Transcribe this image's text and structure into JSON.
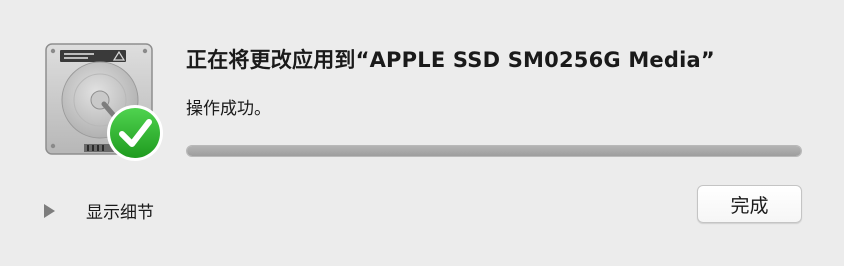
{
  "dialog": {
    "title": "正在将更改应用到“APPLE SSD SM0256G Media”",
    "status": "操作成功。",
    "progress": 1.0,
    "details_label": "显示细节",
    "done_label": "完成"
  },
  "icons": {
    "drive": "hard-drive-icon",
    "success": "checkmark-badge-icon",
    "disclosure": "disclosure-triangle-icon"
  },
  "colors": {
    "background": "#ececec",
    "success_green": "#2fb52f",
    "progress_fill": "#a8a8a8"
  }
}
